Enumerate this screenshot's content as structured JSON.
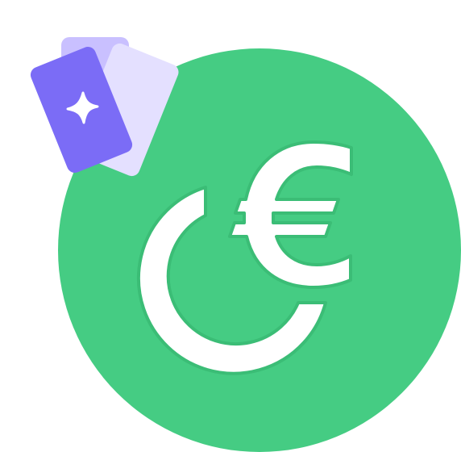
{
  "illustration": {
    "icon_name": "euro-cashback-icon",
    "cards_icon_name": "cards-icon",
    "sparkle_icon_name": "sparkle-icon",
    "colors": {
      "background": "#ffffff",
      "coin": "#45cc83",
      "coin_shadow": "#3bbd76",
      "symbol": "#ffffff",
      "card_back": "#c9c0ff",
      "card_middle": "#e4e0ff",
      "card_front": "#7b6cf6",
      "sparkle": "#ffffff"
    }
  }
}
